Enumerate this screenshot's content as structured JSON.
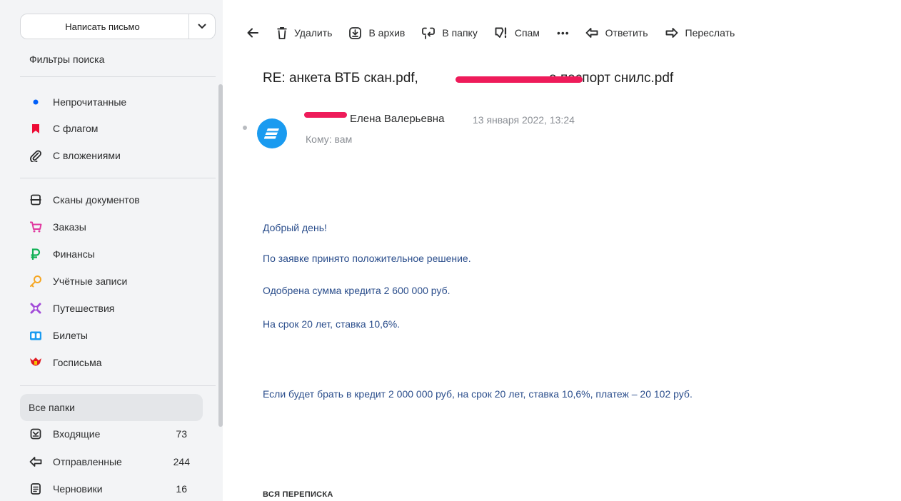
{
  "compose": {
    "label": "Написать письмо"
  },
  "filters": {
    "title": "Фильтры поиска",
    "items": [
      {
        "label": "Непрочитанные",
        "icon": "unread-dot-icon"
      },
      {
        "label": "С флагом",
        "icon": "flag-icon"
      },
      {
        "label": "С вложениями",
        "icon": "paperclip-icon"
      }
    ]
  },
  "categories": [
    {
      "label": "Сканы документов",
      "icon": "scanner-icon"
    },
    {
      "label": "Заказы",
      "icon": "cart-icon"
    },
    {
      "label": "Финансы",
      "icon": "ruble-icon"
    },
    {
      "label": "Учётные записи",
      "icon": "key-icon"
    },
    {
      "label": "Путешествия",
      "icon": "travel-icon"
    },
    {
      "label": "Билеты",
      "icon": "ticket-icon"
    },
    {
      "label": "Госписьма",
      "icon": "gov-emblem-icon"
    }
  ],
  "folders": {
    "all_label": "Все папки",
    "items": [
      {
        "label": "Входящие",
        "count": "73",
        "icon": "inbox-icon"
      },
      {
        "label": "Отправленные",
        "count": "244",
        "icon": "sent-icon"
      },
      {
        "label": "Черновики",
        "count": "16",
        "icon": "drafts-icon"
      }
    ]
  },
  "toolbar": {
    "delete": "Удалить",
    "archive": "В архив",
    "to_folder": "В папку",
    "spam": "Спам",
    "more": "•••",
    "reply": "Ответить",
    "forward": "Переслать"
  },
  "message": {
    "subject_prefix": "RE: анкета ВТБ скан.pdf, ",
    "subject_suffix": "а паспорт снилс.pdf",
    "sender_name": "Елена Валерьевна",
    "date": "13 января 2022, 13:24",
    "to": "Кому: вам",
    "body": [
      "Добрый день!",
      "По заявке принято положительное решение.",
      "Одобрена сумма кредита 2 600 000 руб.",
      "На срок 20 лет, ставка 10,6%.",
      "Если будет брать в кредит 2 000 000 руб, на срок 20 лет, ставка 10,6%, платеж – 20 102 руб."
    ],
    "thread_title": "ВСЯ ПЕРЕПИСКА"
  },
  "colors": {
    "accent": "#1a9bf0",
    "redaction": "#ee1b5a",
    "body_text": "#2b4e8c"
  }
}
